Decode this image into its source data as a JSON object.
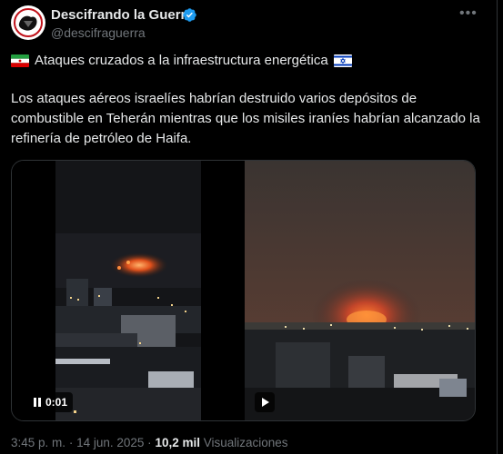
{
  "author": {
    "display_name": "Descifrando la Guerra",
    "handle": "@descifraguerra",
    "verified_icon": "verified-badge-icon"
  },
  "tweet": {
    "headline": "Ataques cruzados a la infraestructura energética",
    "flags": [
      "iran-flag-icon",
      "israel-flag-icon"
    ],
    "text": "Los ataques aéreos israelíes habrían destruido varios depósitos de combustible en Teherán mientras que los misiles iraníes habrían alcanzado la refinería de petróleo de Haifa."
  },
  "media": {
    "left_video_time": "0:01",
    "left_control_icon": "pause-icon",
    "right_control_icon": "play-icon"
  },
  "meta": {
    "time": "3:45 p. m.",
    "separator": "·",
    "date": "14 jun. 2025",
    "views_count": "10,2 mil",
    "views_label": "Visualizaciones"
  },
  "colors": {
    "background": "#000000",
    "text": "#e7e9ea",
    "secondary": "#71767b",
    "verified": "#1d9bf0",
    "fire": "#ff6a1a"
  }
}
